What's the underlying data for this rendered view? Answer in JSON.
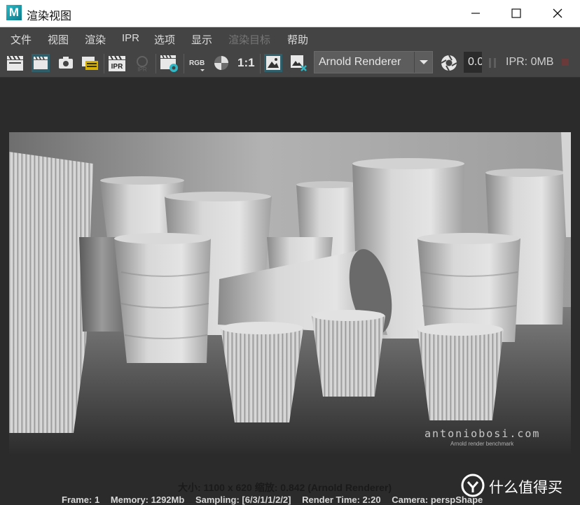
{
  "window": {
    "logo_letter": "M",
    "title": "渲染视图"
  },
  "menu": [
    {
      "label": "文件",
      "enabled": true
    },
    {
      "label": "视图",
      "enabled": true
    },
    {
      "label": "渲染",
      "enabled": true
    },
    {
      "label": "IPR",
      "enabled": true
    },
    {
      "label": "选项",
      "enabled": true
    },
    {
      "label": "显示",
      "enabled": true
    },
    {
      "label": "渲染目标",
      "enabled": false
    },
    {
      "label": "帮助",
      "enabled": true
    }
  ],
  "toolbar": {
    "ipr_label": "IPR",
    "ipr_disabled_label": "IPR",
    "rgb_label": "RGB",
    "ratio_label": "1:1",
    "renderer": "Arnold Renderer",
    "exposure": "0.0",
    "ipr_memory": "IPR: 0MB"
  },
  "render": {
    "watermark_url": "antoniobosi.com",
    "watermark_sub": "Arnold render benchmark"
  },
  "status": {
    "size_info": "大小: 1100 x 620 缩放: 0.842    (Arnold Renderer)",
    "frame": "Frame: 1",
    "memory": "Memory: 1292Mb",
    "sampling": "Sampling: [6/3/1/1/2/2]",
    "render_time": "Render Time: 2:20",
    "camera": "Camera: perspShape"
  },
  "overlay": {
    "site_watermark": "什么值得买"
  },
  "colors": {
    "titlebar": "#ffffff",
    "panel": "#444444",
    "viewport": "#2b2b2b",
    "accent": "#2fb8c5"
  }
}
